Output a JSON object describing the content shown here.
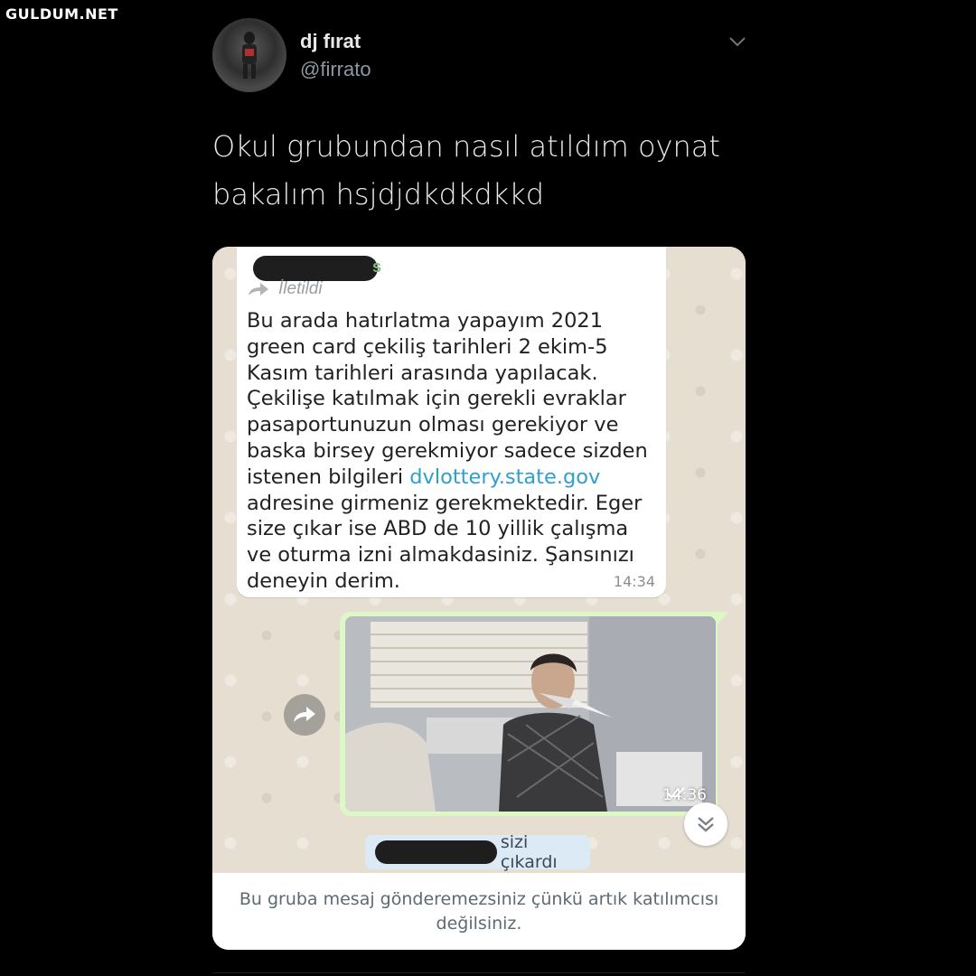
{
  "watermark": "GULDUM.NET",
  "tweet": {
    "display_name": "dj fırat",
    "handle": "@firrato",
    "text_lines": [
      "Okul grubundan nasıl atıldım oynat",
      "bakalım hsjdjdkdkdkkd"
    ]
  },
  "chat": {
    "forwarded_label": "İletildi",
    "sender_suffix": "s",
    "message_lines": [
      "Bu arada hatırlatma yapayım 2021",
      "green card  çekiliş tarihleri 2 ekim-5",
      "Kasım tarihleri arasında yapılacak.",
      "Çekilişe katılmak için gerekli evraklar",
      "pasaportunuzun olması gerekiyor ve",
      "baska birsey gerekmiyor sadece sizden"
    ],
    "link_prefix": "istenen bilgileri ",
    "link_text": "dvlottery.state.gov",
    "message_lines_after": [
      "adresine girmeniz gerekmektedir. Eger",
      "size çıkar ise ABD de 10 yillik çalışma",
      "ve oturma izni almakdasiniz. Şansınızı",
      "deneyin derim."
    ],
    "incoming_time": "14:34",
    "photo_time": "14:36",
    "system_message": "sizi çıkardı",
    "footer_lines": [
      "Bu gruba mesaj gönderemezsiniz çünkü artık katılımcısı",
      "değilsiniz."
    ]
  },
  "icons": {
    "menu": "chevron-down-icon",
    "forward": "forward-arrow-icon",
    "scroll": "double-chevron-down-icon",
    "read": "double-check-icon"
  },
  "colors": {
    "background": "#000000",
    "link": "#2f9fd0",
    "outgoing_bubble": "#dcf8c6",
    "system_bubble": "#dbeaf4"
  }
}
